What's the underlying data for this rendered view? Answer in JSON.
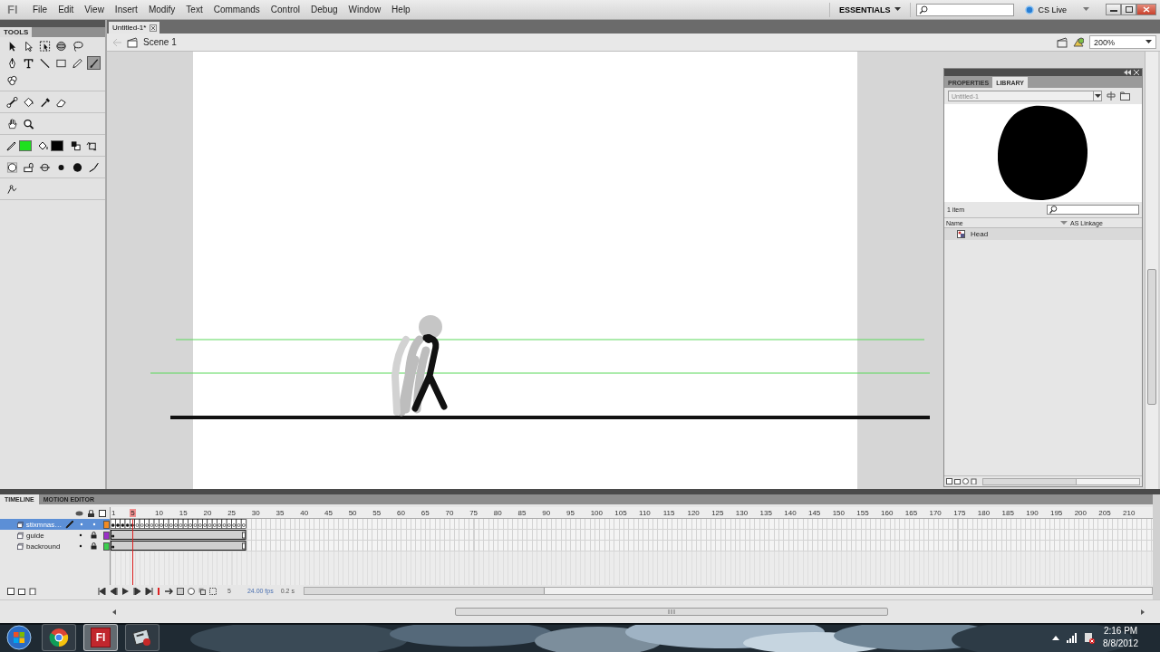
{
  "menubar": {
    "logo": "Fl",
    "menus": [
      "File",
      "Edit",
      "View",
      "Insert",
      "Modify",
      "Text",
      "Commands",
      "Control",
      "Debug",
      "Window",
      "Help"
    ],
    "workspace": "ESSENTIALS",
    "cs_live": "CS Live"
  },
  "tools": {
    "title": "TOOLS",
    "rows": [
      [
        {
          "kind": "arrow",
          "selected": false
        },
        {
          "kind": "subselect",
          "selected": false
        },
        {
          "kind": "free-transform",
          "selected": false
        },
        {
          "kind": "rotation",
          "selected": false
        },
        {
          "kind": "lasso",
          "selected": false
        }
      ],
      [
        {
          "kind": "pen",
          "selected": false
        },
        {
          "kind": "text",
          "selected": false
        },
        {
          "kind": "line",
          "selected": false
        },
        {
          "kind": "rectangle",
          "selected": false
        },
        {
          "kind": "pencil",
          "selected": false
        },
        {
          "kind": "brush",
          "selected": true
        }
      ],
      [
        {
          "kind": "deco",
          "selected": false
        }
      ],
      [
        {
          "kind": "bone",
          "selected": false
        },
        {
          "kind": "paint-bucket",
          "selected": false
        },
        {
          "kind": "eyedropper",
          "selected": false
        },
        {
          "kind": "eraser",
          "selected": false
        }
      ],
      [
        {
          "kind": "hand",
          "selected": false
        },
        {
          "kind": "zoom",
          "selected": false
        }
      ],
      [
        {
          "kind": "stroke-color",
          "color": "#1ee01e"
        },
        {
          "kind": "fill-color",
          "color": "#000000"
        },
        {
          "kind": "default-colors"
        },
        {
          "kind": "swap-colors"
        }
      ],
      [
        {
          "kind": "object-drawing"
        },
        {
          "kind": "lock-fill"
        },
        {
          "kind": "snap"
        },
        {
          "kind": "dot-small"
        },
        {
          "kind": "dot-large"
        },
        {
          "kind": "brush-shape"
        }
      ],
      [
        {
          "kind": "bind",
          "selected": false
        }
      ]
    ]
  },
  "document": {
    "tab": "Untitled-1*",
    "scene": "Scene 1",
    "zoom": "200%"
  },
  "library": {
    "tabs": [
      {
        "label": "PROPERTIES",
        "selected": false
      },
      {
        "label": "LIBRARY",
        "selected": true
      }
    ],
    "document": "Untitled-1",
    "count": "1 item",
    "columns": [
      "Name",
      "AS Linkage"
    ],
    "items": [
      {
        "name": "Head"
      }
    ]
  },
  "timeline": {
    "tabs": [
      {
        "label": "TIMELINE",
        "selected": true
      },
      {
        "label": "MOTION EDITOR",
        "selected": false
      }
    ],
    "frame_numbers": [
      {
        "label": "1",
        "selected": false
      },
      {
        "label": "5",
        "selected": true
      },
      {
        "label": "10",
        "selected": false
      },
      {
        "label": "15",
        "selected": false
      },
      {
        "label": "20",
        "selected": false
      },
      {
        "label": "25",
        "selected": false
      },
      {
        "label": "30",
        "selected": false
      },
      {
        "label": "35",
        "selected": false
      },
      {
        "label": "40",
        "selected": false
      },
      {
        "label": "45",
        "selected": false
      },
      {
        "label": "50",
        "selected": false
      },
      {
        "label": "55",
        "selected": false
      },
      {
        "label": "60",
        "selected": false
      },
      {
        "label": "65",
        "selected": false
      },
      {
        "label": "70",
        "selected": false
      },
      {
        "label": "75",
        "selected": false
      },
      {
        "label": "80",
        "selected": false
      },
      {
        "label": "85",
        "selected": false
      },
      {
        "label": "90",
        "selected": false
      },
      {
        "label": "95",
        "selected": false
      },
      {
        "label": "100",
        "selected": false
      },
      {
        "label": "105",
        "selected": false
      },
      {
        "label": "110",
        "selected": false
      },
      {
        "label": "115",
        "selected": false
      },
      {
        "label": "120",
        "selected": false
      },
      {
        "label": "125",
        "selected": false
      },
      {
        "label": "130",
        "selected": false
      },
      {
        "label": "135",
        "selected": false
      },
      {
        "label": "140",
        "selected": false
      },
      {
        "label": "145",
        "selected": false
      },
      {
        "label": "150",
        "selected": false
      },
      {
        "label": "155",
        "selected": false
      },
      {
        "label": "160",
        "selected": false
      },
      {
        "label": "165",
        "selected": false
      },
      {
        "label": "170",
        "selected": false
      },
      {
        "label": "175",
        "selected": false
      },
      {
        "label": "180",
        "selected": false
      },
      {
        "label": "185",
        "selected": false
      },
      {
        "label": "190",
        "selected": false
      },
      {
        "label": "195",
        "selected": false
      },
      {
        "label": "200",
        "selected": false
      },
      {
        "label": "205",
        "selected": false
      },
      {
        "label": "210",
        "selected": false
      }
    ],
    "layers": [
      {
        "name": "stixmnas…",
        "selected": true,
        "locked": false,
        "color": "#f08a24",
        "kind": "keyframes"
      },
      {
        "name": "guide",
        "selected": false,
        "locked": true,
        "color": "#9b30c8",
        "kind": "span"
      },
      {
        "name": "backround",
        "selected": false,
        "locked": true,
        "color": "#3ccf4e",
        "kind": "span"
      }
    ],
    "current_frame": "5",
    "frame_rate": "24.00 fps",
    "elapsed_time": "0.2 s"
  },
  "taskbar": {
    "apps": [
      {
        "kind": "browser",
        "selected": false
      },
      {
        "kind": "flash",
        "label": "Fl",
        "selected": true
      },
      {
        "kind": "utility",
        "selected": false
      }
    ],
    "time": "2:16 PM",
    "date": "8/8/2012"
  }
}
